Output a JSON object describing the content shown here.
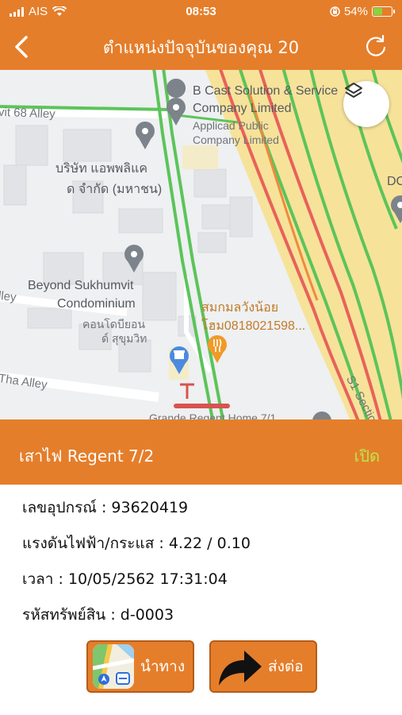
{
  "status_bar": {
    "carrier": "AIS",
    "time": "08:53",
    "battery": "54%",
    "battery_level": 0.54
  },
  "nav": {
    "title": "ตำแหน่งปัจจุบันของคุณ 20"
  },
  "map": {
    "labels": {
      "vit68": "vit 68 Alley",
      "bcast1": "B Cast Solution & Service",
      "bcast2": "Company Limited",
      "applicad1": "Applicad Public",
      "applicad2": "Company Limited",
      "dc": "DC",
      "thai_co1": "บริษัท แอพพลิแค",
      "thai_co2": "ด จำกัด (มหาชน)",
      "beyond1": "Beyond Sukhumvit",
      "beyond2": "Condominium",
      "beyond_th1": "คอนโดบียอน",
      "beyond_th2": "ด์ สุขุมวิท",
      "alley": "lley",
      "tha_alley": "Tha Alley",
      "restaurant1": "สมกมลวังน้อย",
      "restaurant2": "โฮม0818021598...",
      "section": "S1 Sectio",
      "regent": "Grande Regent Home 7/1"
    }
  },
  "info": {
    "title": "เสาไฟ Regent 7/2",
    "status": "เปิด",
    "rows": {
      "device": "เลขอุปกรณ์ : 93620419",
      "voltage": "แรงดันไฟฟ้า/กระแส : 4.22 / 0.10",
      "time": "เวลา : 10/05/2562 17:31:04",
      "asset": "รหัสทรัพย์สิน : d-0003"
    }
  },
  "buttons": {
    "navigate": "นำทาง",
    "forward": "ส่งต่อ"
  },
  "colors": {
    "accent": "#e57e2b",
    "status_on": "#b9e84a"
  }
}
